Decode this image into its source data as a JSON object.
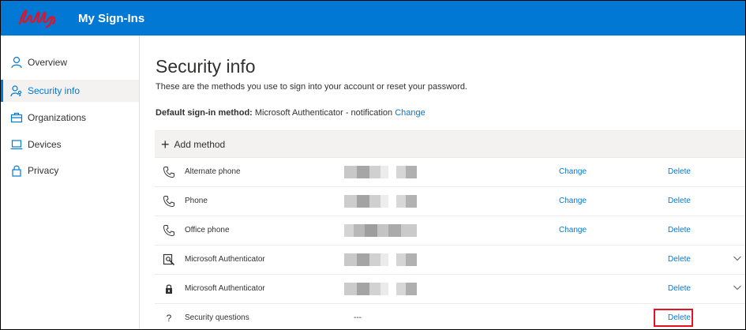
{
  "header": {
    "brand": "Lilly",
    "app_title": "My Sign-Ins",
    "background": "#0078d4",
    "logo_color": "#e81123"
  },
  "sidebar": {
    "items": [
      {
        "label": "Overview",
        "icon": "person-icon",
        "active": false
      },
      {
        "label": "Security info",
        "icon": "person-key-icon",
        "active": true
      },
      {
        "label": "Organizations",
        "icon": "briefcase-icon",
        "active": false
      },
      {
        "label": "Devices",
        "icon": "laptop-icon",
        "active": false
      },
      {
        "label": "Privacy",
        "icon": "lock-icon",
        "active": false
      }
    ]
  },
  "main": {
    "title": "Security info",
    "description": "These are the methods you use to sign into your account or reset your password.",
    "default_method": {
      "label": "Default sign-in method:",
      "value": "Microsoft Authenticator - notification",
      "change_label": "Change"
    },
    "add_method_label": "Add method",
    "methods": [
      {
        "name": "Alternate phone",
        "icon": "phone-icon",
        "value": "",
        "change": "Change",
        "delete": "Delete",
        "expandable": false
      },
      {
        "name": "Phone",
        "icon": "phone-icon",
        "value": "",
        "change": "Change",
        "delete": "Delete",
        "expandable": false
      },
      {
        "name": "Office phone",
        "icon": "phone-icon",
        "value": "",
        "change": "Change",
        "delete": "Delete",
        "expandable": false
      },
      {
        "name": "Microsoft Authenticator",
        "icon": "authenticator-icon",
        "value": "",
        "change": "",
        "delete": "Delete",
        "expandable": true
      },
      {
        "name": "Microsoft Authenticator",
        "icon": "lock-device-icon",
        "value": "",
        "change": "",
        "delete": "Delete",
        "expandable": true
      },
      {
        "name": "Security questions",
        "icon": "question-icon",
        "value": "---",
        "change": "",
        "delete": "Delete",
        "expandable": false
      }
    ]
  },
  "colors": {
    "accent": "#0078d4",
    "highlight": "#e81123",
    "redacted": "#b4b4b4"
  }
}
